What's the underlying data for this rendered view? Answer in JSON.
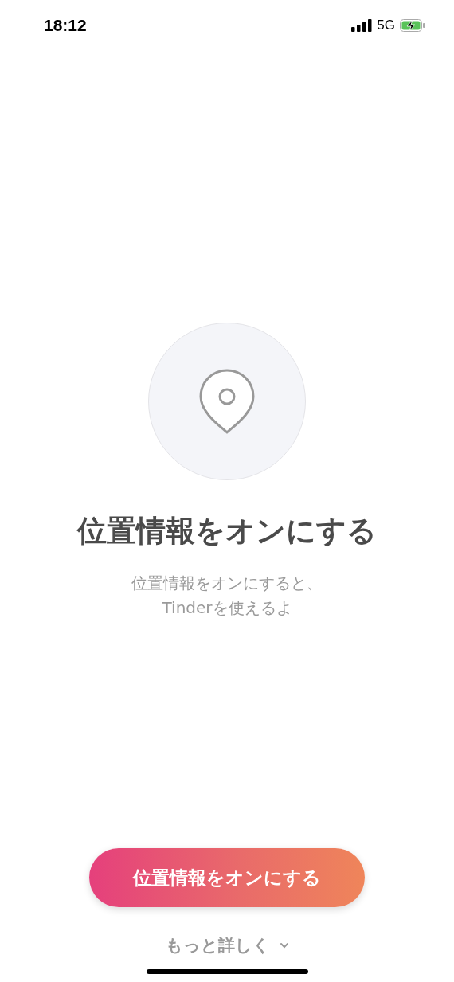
{
  "status_bar": {
    "time": "18:12",
    "network": "5G"
  },
  "title": "位置情報をオンにする",
  "description": [
    "位置情報をオンにすると、",
    "Tinderを使えるよ"
  ],
  "primary_button": {
    "label": "位置情報をオンにする"
  },
  "more_link": {
    "label": "もっと詳しく"
  }
}
